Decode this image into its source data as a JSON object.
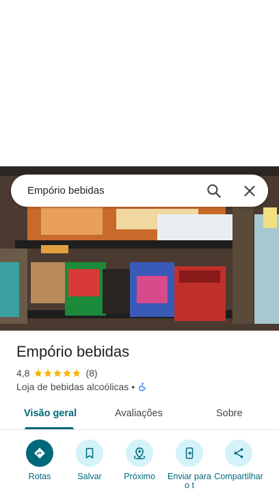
{
  "search": {
    "query": "Empório bebidas"
  },
  "place": {
    "name": "Empório bebidas",
    "rating": "4,8",
    "stars": 5,
    "review_count": "(8)",
    "category": "Loja de bebidas alcoólicas",
    "separator": "•",
    "accessibility_icon": "wheelchair-icon"
  },
  "tabs": [
    {
      "label": "Visão geral",
      "active": true
    },
    {
      "label": "Avaliações",
      "active": false
    },
    {
      "label": "Sobre",
      "active": false
    }
  ],
  "actions": [
    {
      "label": "Rotas",
      "icon": "directions-icon"
    },
    {
      "label": "Salvar",
      "icon": "bookmark-icon"
    },
    {
      "label": "Próximo",
      "icon": "nearby-icon"
    },
    {
      "label": "Enviar para o t",
      "icon": "send-to-phone-icon"
    },
    {
      "label": "Compartilhar",
      "icon": "share-icon"
    }
  ],
  "colors": {
    "accent": "#00687a",
    "accent_light": "#d4f2fa",
    "star": "#f4b400",
    "accessibility_blue": "#1a73e8"
  }
}
